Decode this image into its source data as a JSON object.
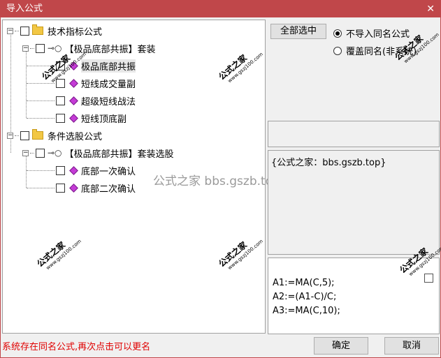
{
  "window": {
    "title": "导入公式",
    "close_glyph": "✕"
  },
  "tree": {
    "group1_label": "技术指标公式",
    "suite1_label": "【极品底部共振】套装",
    "items1": [
      "极品底部共振",
      "短线成交量副",
      "超级短线战法",
      "短线顶底副"
    ],
    "group2_label": "条件选股公式",
    "suite2_label": "【极品底部共振】套装选股",
    "items2": [
      "底部一次确认",
      "底部二次确认"
    ]
  },
  "right": {
    "select_all_label": "全部选中",
    "radio1_label": "不导入同名公式",
    "radio2_label": "覆盖同名(非系统)",
    "description": "{公式之家：bbs.gszb.top}",
    "code_lines": [
      "A1:=MA(C,5);",
      "A2:=(A1-C)/C;",
      "A3:=MA(C,10);"
    ]
  },
  "footer": {
    "status": "系统存在同名公式,再次点击可以更名",
    "ok_label": "确定",
    "cancel_label": "取消"
  },
  "watermarks": {
    "main": "公式之家",
    "sub": "www.gszj100.com",
    "center": "公式之家 bbs.gszb.top"
  }
}
